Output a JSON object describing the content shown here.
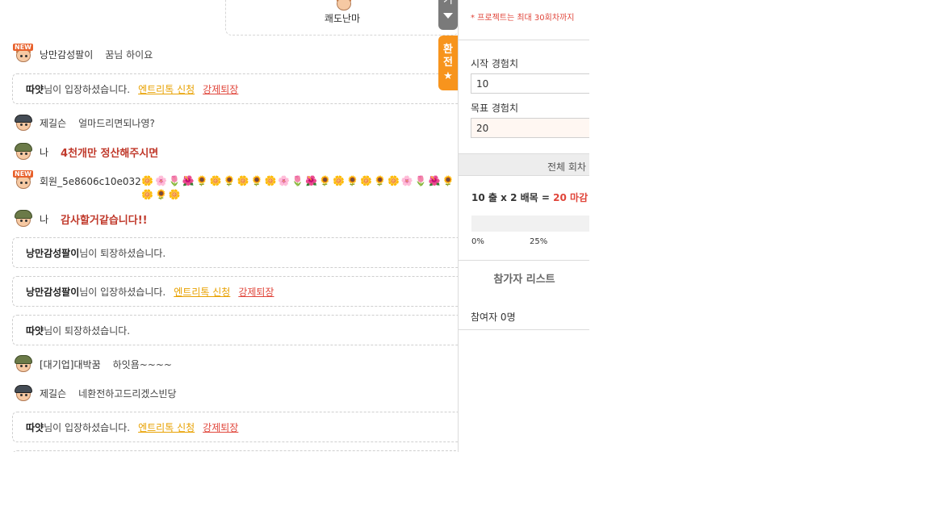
{
  "chat": {
    "top_card": {
      "name": "쾌도난마",
      "partial_text": "[..] .."
    },
    "messages": [
      {
        "user": "낭만감성팔이",
        "text": "꿈님 하이요",
        "avatar": "new-badge-avatar"
      },
      {
        "user": "제길슨",
        "text": "얼마드리면되나영?",
        "avatar": "cap-avatar"
      },
      {
        "user": "나",
        "text": "4천개만 정산해주시면",
        "avatar": "soldier-avatar"
      },
      {
        "user": "회원_5e8606c10e032",
        "text": "🌼🌸🌷🌺🌻🌼🌻🌼🌻🌼🌸🌷🌺🌻🌼🌻🌼🌻🌼🌸🌷🌺🌻🌼🌻🌼",
        "avatar": "new-badge-avatar"
      },
      {
        "user": "나",
        "text": "감사할거같습니다!!",
        "avatar": "soldier-avatar"
      },
      {
        "user": "[대기업]대박꿈",
        "text": "하잇욤~~~~",
        "avatar": "soldier-avatar"
      },
      {
        "user": "제길슨",
        "text": "네환전하고드리겠스빈당",
        "avatar": "cap-avatar"
      }
    ],
    "system": [
      {
        "name": "따얏",
        "suffix": "님이 입장하셨습니다.",
        "entry": "엔트리톡 신청",
        "kick": "강제퇴장"
      },
      {
        "name": "낭만감성팔이",
        "suffix": "님이 퇴장하셨습니다."
      },
      {
        "name": "낭만감성팔이",
        "suffix": "님이 입장하셨습니다.",
        "entry": "엔트리톡 신청",
        "kick": "강제퇴장"
      },
      {
        "name": "따얏",
        "suffix": "님이 퇴장하셨습니다."
      },
      {
        "name": "따얏",
        "suffix": "님이 입장하셨습니다.",
        "entry": "엔트리톡 신청",
        "kick": "강제퇴장"
      }
    ]
  },
  "side_tabs": {
    "gray": "기",
    "orange": [
      "환",
      "전"
    ],
    "orange_icon": "star-icon"
  },
  "panel": {
    "notice": "* 프로젝트는 최대 30회차까지",
    "start_label": "시작 경험치",
    "start_value": "10",
    "target_label": "목표 경험치",
    "target_value": "20",
    "total_label": "전체 회차",
    "formula": {
      "a": "10",
      "a_unit": "출",
      "x": "x",
      "b": "2",
      "b_unit": "배목",
      "eq": "=",
      "result": "20",
      "result_unit": "마감 !"
    },
    "progress": 0,
    "ticks": [
      "0%",
      "25%"
    ],
    "participants_title": "참가자 리스트",
    "participants_count": "참여자 0명"
  },
  "colors": {
    "accent_orange": "#f7941d",
    "alert_red": "#e0453a",
    "entry_yellow": "#e8a100"
  }
}
